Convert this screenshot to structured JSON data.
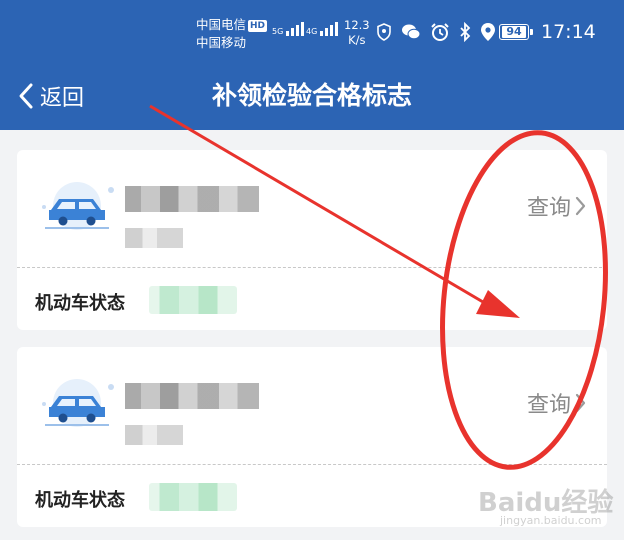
{
  "status": {
    "carrier1": "中国电信",
    "carrier_hd": "HD",
    "carrier2": "中国移动",
    "sig1_label": "5G",
    "sig2_label": "4G",
    "speed_value": "12.3",
    "speed_unit": "K/s",
    "battery": "94",
    "time": "17:14"
  },
  "nav": {
    "back_label": "返回",
    "title": "补领检验合格标志"
  },
  "cards": [
    {
      "query_label": "查询",
      "status_label": "机动车状态"
    },
    {
      "query_label": "查询",
      "status_label": "机动车状态"
    }
  ],
  "watermark": {
    "text": "Baidu经验",
    "url": "jingyan.baidu.com"
  },
  "colors": {
    "header": "#2c64b4",
    "annotation": "#e8332d",
    "background": "#f2f3f5"
  },
  "icons": [
    "chevron-left-icon",
    "car-icon",
    "chevron-right-icon",
    "alarm-icon",
    "bluetooth-icon",
    "location-icon",
    "wechat-icon",
    "shield-icon"
  ]
}
